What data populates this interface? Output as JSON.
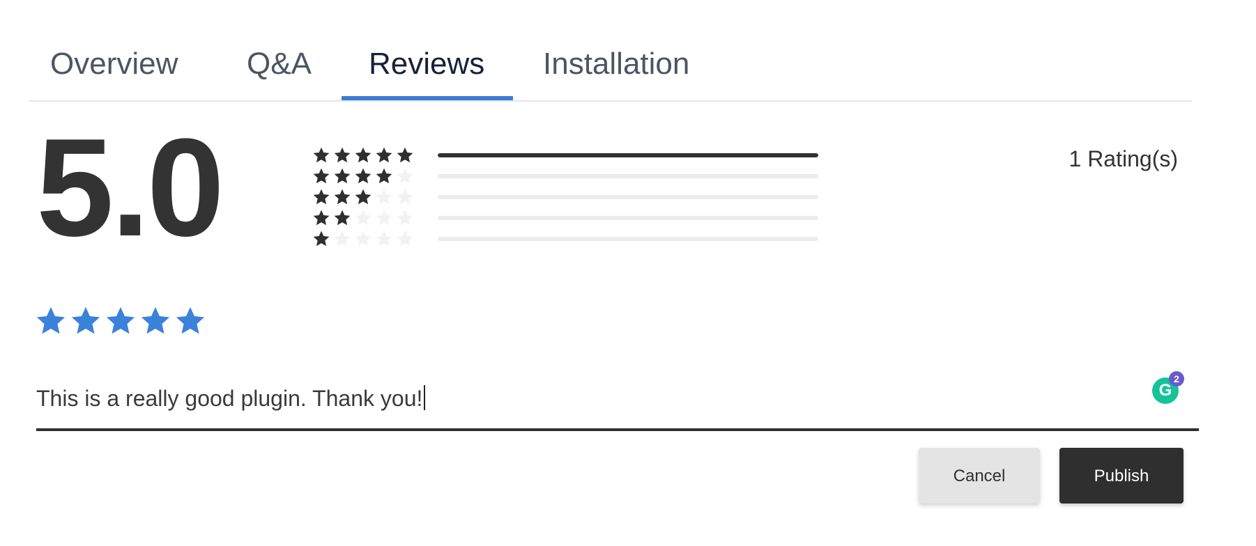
{
  "tabs": [
    {
      "label": "Overview",
      "active": false
    },
    {
      "label": "Q&A",
      "active": false
    },
    {
      "label": "Reviews",
      "active": true
    },
    {
      "label": "Installation",
      "active": false
    }
  ],
  "summary": {
    "average": "5.0",
    "rating_count": "1 Rating(s)",
    "distribution": [
      {
        "stars": 5,
        "share": 1.0
      },
      {
        "stars": 4,
        "share": 0.0
      },
      {
        "stars": 3,
        "share": 0.0
      },
      {
        "stars": 2,
        "share": 0.0
      },
      {
        "stars": 1,
        "share": 0.0
      }
    ]
  },
  "review_form": {
    "selected_rating": 5,
    "text": "This is a really good plugin. Thank you!",
    "grammarly": {
      "letter": "G",
      "count": "2"
    },
    "cancel_label": "Cancel",
    "publish_label": "Publish"
  },
  "colors": {
    "accent": "#3b7bd6",
    "star_filled": "#2f2f2f",
    "star_empty": "#f2f2f2",
    "input_star": "#3b82db",
    "grammarly": "#15c39a",
    "grammarly_badge": "#6a5acd"
  },
  "icons": {
    "star": "star-icon",
    "grammarly": "grammarly-icon"
  }
}
